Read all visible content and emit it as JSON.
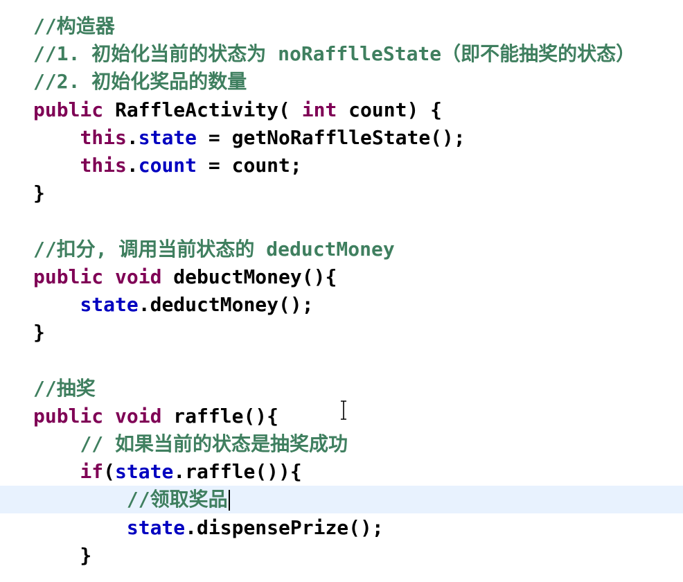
{
  "editor": {
    "line_highlight_color": "#e8f2fe",
    "colors": {
      "comment": "#3f7f5f",
      "keyword": "#7f0055",
      "field": "#0000c0",
      "plain": "#000000"
    },
    "lines": [
      [
        {
          "t": "comment",
          "s": "//构造器"
        }
      ],
      [
        {
          "t": "comment",
          "s": "//1. 初始化当前的状态为 noRafflleState（即不能抽奖的状态）"
        }
      ],
      [
        {
          "t": "comment",
          "s": "//2. 初始化奖品的数量"
        }
      ],
      [
        {
          "t": "kw",
          "s": "public "
        },
        {
          "t": "plain",
          "s": "RaffleActivity( "
        },
        {
          "t": "kw",
          "s": "int "
        },
        {
          "t": "plain",
          "s": "count) {"
        }
      ],
      [
        {
          "t": "plain",
          "s": "    "
        },
        {
          "t": "kw",
          "s": "this"
        },
        {
          "t": "plain",
          "s": "."
        },
        {
          "t": "field",
          "s": "state"
        },
        {
          "t": "plain",
          "s": " = getNoRafflleState();"
        }
      ],
      [
        {
          "t": "plain",
          "s": "    "
        },
        {
          "t": "kw",
          "s": "this"
        },
        {
          "t": "plain",
          "s": "."
        },
        {
          "t": "field",
          "s": "count"
        },
        {
          "t": "plain",
          "s": " = count;"
        }
      ],
      [
        {
          "t": "plain",
          "s": "}"
        }
      ],
      [],
      [
        {
          "t": "comment",
          "s": "//扣分, 调用当前状态的 deductMoney"
        }
      ],
      [
        {
          "t": "kw",
          "s": "public void "
        },
        {
          "t": "plain",
          "s": "debuctMoney(){"
        }
      ],
      [
        {
          "t": "plain",
          "s": "    "
        },
        {
          "t": "field",
          "s": "state"
        },
        {
          "t": "plain",
          "s": ".deductMoney();"
        }
      ],
      [
        {
          "t": "plain",
          "s": "}"
        }
      ],
      [],
      [
        {
          "t": "comment",
          "s": "//抽奖"
        }
      ],
      [
        {
          "t": "kw",
          "s": "public void "
        },
        {
          "t": "plain",
          "s": "raffle(){"
        }
      ],
      [
        {
          "t": "plain",
          "s": "    "
        },
        {
          "t": "comment",
          "s": "// 如果当前的状态是抽奖成功"
        }
      ],
      [
        {
          "t": "plain",
          "s": "    "
        },
        {
          "t": "kw",
          "s": "if"
        },
        {
          "t": "plain",
          "s": "("
        },
        {
          "t": "field",
          "s": "state"
        },
        {
          "t": "plain",
          "s": ".raffle()){"
        }
      ],
      [
        {
          "t": "plain",
          "s": "        "
        },
        {
          "t": "comment",
          "s": "//领取奖品"
        }
      ],
      [
        {
          "t": "plain",
          "s": "        "
        },
        {
          "t": "field",
          "s": "state"
        },
        {
          "t": "plain",
          "s": ".dispensePrize();"
        }
      ],
      [
        {
          "t": "plain",
          "s": "    }"
        }
      ]
    ],
    "current_line": 17,
    "caret_line": 17
  }
}
